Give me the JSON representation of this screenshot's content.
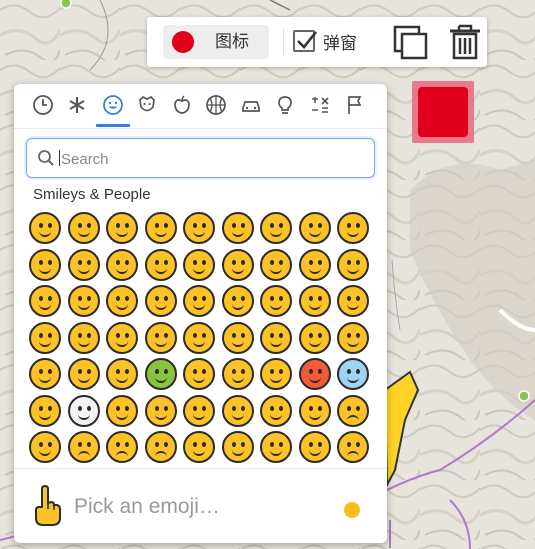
{
  "toolbar": {
    "icon_label": "图标",
    "popup_label": "弹窗",
    "popup_checked": true,
    "marker_color": "#e0001b"
  },
  "picker": {
    "categories": [
      {
        "name": "recent-icon"
      },
      {
        "name": "custom-icon"
      },
      {
        "name": "smileys-people-icon",
        "active": true
      },
      {
        "name": "animals-nature-icon"
      },
      {
        "name": "food-drink-icon"
      },
      {
        "name": "activity-icon"
      },
      {
        "name": "travel-places-icon"
      },
      {
        "name": "objects-icon"
      },
      {
        "name": "symbols-icon"
      },
      {
        "name": "flags-icon"
      }
    ],
    "search_placeholder": "Search",
    "section_title": "Smileys & People",
    "emoji_rows": 7,
    "emoji_cols": 9,
    "footer_preview": "Pick an emoji…",
    "skin_tone_color": "#f9bc1f"
  },
  "colors": {
    "accent": "#3b7ddd",
    "emoji_yellow": "#fdc225",
    "route_purple": "#b07acb",
    "highlight_yellow": "#ffd424"
  }
}
